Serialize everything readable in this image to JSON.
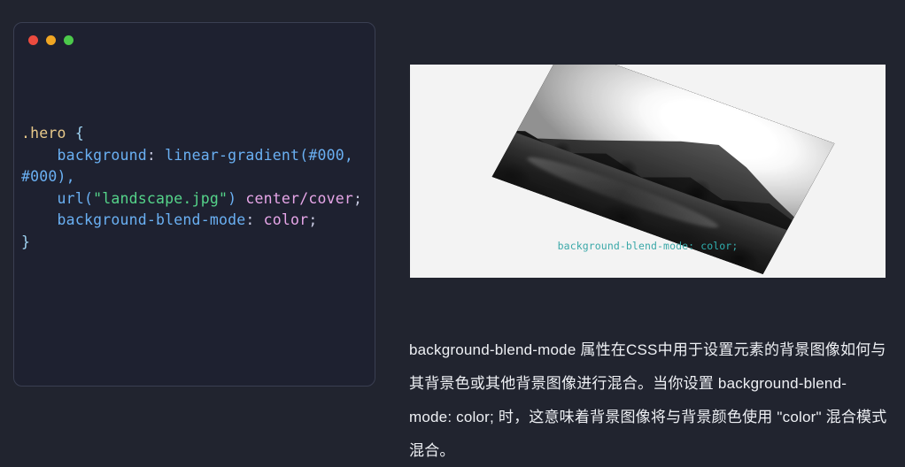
{
  "window": {
    "dots": [
      {
        "name": "close-dot",
        "color": "#ec4b3f"
      },
      {
        "name": "minimize-dot",
        "color": "#f0a623"
      },
      {
        "name": "maximize-dot",
        "color": "#4cc94b"
      }
    ]
  },
  "code": {
    "language": "css",
    "lines": [
      {
        "tokens": [
          {
            "t": ".hero",
            "c": "sel"
          },
          {
            "t": " ",
            "c": "punc"
          },
          {
            "t": "{",
            "c": "brace"
          }
        ]
      },
      {
        "tokens": [
          {
            "t": "    ",
            "c": "punc"
          },
          {
            "t": "background",
            "c": "prop"
          },
          {
            "t": ": ",
            "c": "punc"
          },
          {
            "t": "linear-gradient",
            "c": "fn"
          },
          {
            "t": "(",
            "c": "fn"
          },
          {
            "t": "#000",
            "c": "num"
          },
          {
            "t": ", ",
            "c": "fn"
          },
          {
            "t": "#000",
            "c": "num"
          },
          {
            "t": "),",
            "c": "fn"
          }
        ]
      },
      {
        "tokens": [
          {
            "t": "    ",
            "c": "punc"
          },
          {
            "t": "url",
            "c": "fn"
          },
          {
            "t": "(",
            "c": "fn"
          },
          {
            "t": "\"landscape.jpg\"",
            "c": "str"
          },
          {
            "t": ")",
            "c": "fn"
          },
          {
            "t": " ",
            "c": "punc"
          },
          {
            "t": "center/cover",
            "c": "val"
          },
          {
            "t": ";",
            "c": "punc"
          }
        ]
      },
      {
        "tokens": [
          {
            "t": "    ",
            "c": "punc"
          },
          {
            "t": "background-blend-mode",
            "c": "prop"
          },
          {
            "t": ": ",
            "c": "punc"
          },
          {
            "t": "color",
            "c": "val"
          },
          {
            "t": ";",
            "c": "punc"
          }
        ]
      },
      {
        "tokens": [
          {
            "t": "}",
            "c": "brace"
          }
        ]
      }
    ],
    "colors": {
      "selector": "#e8c98a",
      "brace": "#9fd4f2",
      "property": "#6ab0f3",
      "function": "#6ab0f3",
      "number": "#6ab0f3",
      "string": "#55d48a",
      "value": "#e7a6e8",
      "punctuation": "#c7c9e0",
      "card_background": "#1e2130",
      "page_background": "#21242f"
    }
  },
  "demo": {
    "caption_property": "background-blend-mode",
    "caption_separator": ": ",
    "caption_value": "color",
    "caption_terminator": ";",
    "image_alt": "grayscale mountain landscape with trees, skewed in 3D",
    "panel_background": "#f3f3f3",
    "caption_color": "#2fb0b0"
  },
  "description": {
    "paragraph": "background-blend-mode  属性在CSS中用于设置元素的背景图像如何与其背景色或其他背景图像进行混合。当你设置 background-blend-mode: color; 时，这意味着背景图像将与背景颜色使用 \"color\" 混合模式混合。",
    "text_color": "#eef0f4"
  }
}
